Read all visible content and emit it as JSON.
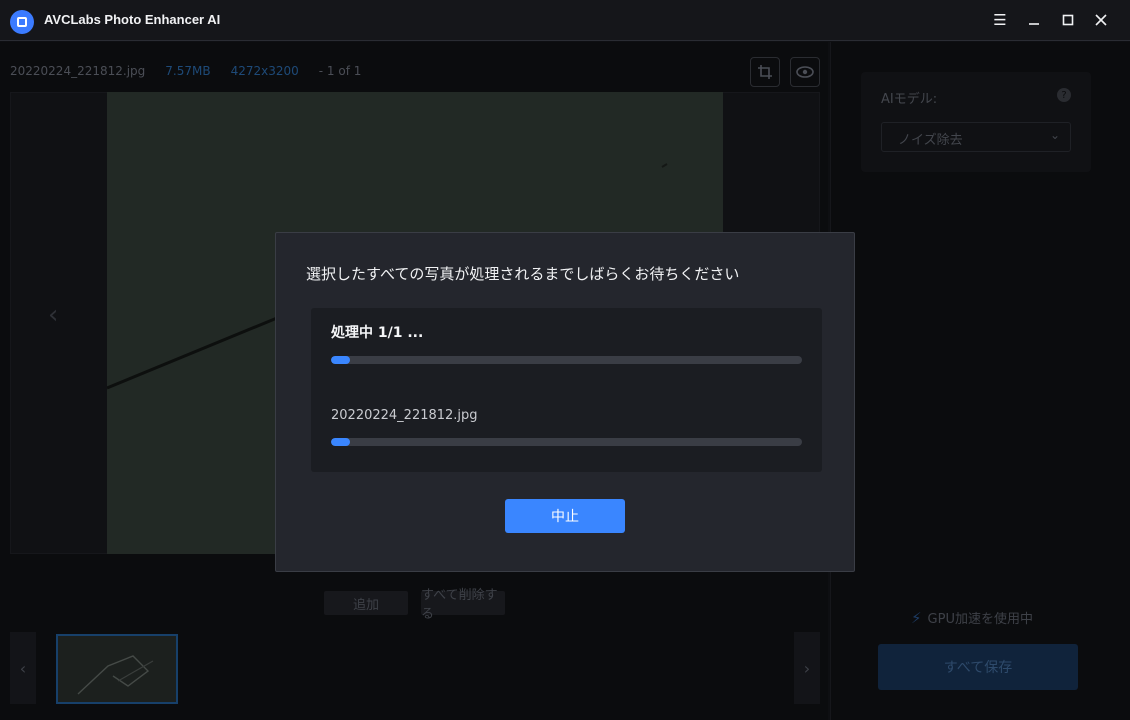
{
  "window": {
    "title": "AVCLabs Photo Enhancer AI"
  },
  "file_info": {
    "name": "20220224_221812.jpg",
    "size": "7.57MB",
    "dimensions": "4272x3200",
    "page": "- 1 of 1"
  },
  "actions": {
    "add": "追加",
    "remove_all": "すべて削除する"
  },
  "right_panel": {
    "model_label": "AIモデル:",
    "model_value": "ノイズ除去",
    "gpu_text": "GPU加速を使用中",
    "save_all": "すべて保存"
  },
  "dialog": {
    "title": "選択したすべての写真が処理されるまでしばらくお待ちください",
    "status": "処理中 1/1 ...",
    "overall_progress": 0.04,
    "file_name": "20220224_221812.jpg",
    "file_progress": 0.04,
    "cancel_label": "中止"
  },
  "colors": {
    "accent": "#3a86ff",
    "dialog_bg": "#24262d"
  },
  "icons": {
    "logo": "app-logo-icon",
    "menu": "menu-icon",
    "minimize": "minimize-icon",
    "maximize": "maximize-icon",
    "close": "close-icon",
    "crop": "crop-icon",
    "preview": "eye-icon",
    "help": "help-icon",
    "gpu": "bolt-icon"
  }
}
